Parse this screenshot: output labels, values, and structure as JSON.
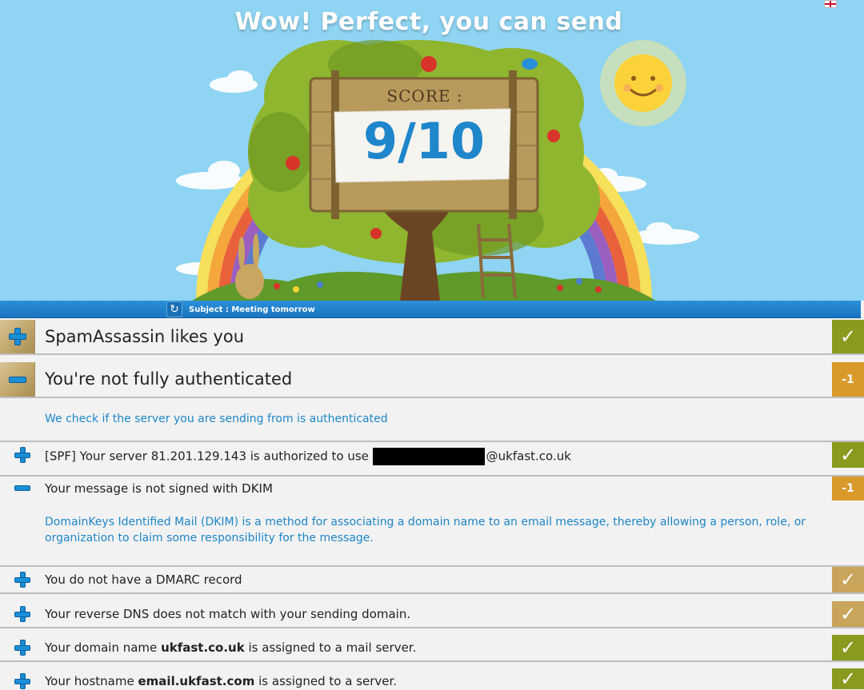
{
  "hero": {
    "title": "Wow! Perfect, you can send",
    "score_label": "SCORE :",
    "score_value": "9/10"
  },
  "subject_bar": {
    "text": "Subject : Meeting tomorrow"
  },
  "sections": [
    {
      "title": "SpamAssassin likes you",
      "state": "collapsed",
      "badge": "✓",
      "badge_color": "#8a9a1e"
    },
    {
      "title": "You're not fully authenticated",
      "state": "expanded",
      "badge": "-1",
      "badge_color": "#d99a2b",
      "description": "We check if the server you are sending from is authenticated"
    }
  ],
  "checks": [
    {
      "prefix": "[SPF] Your server 81.201.129.143 is authorized to use",
      "suffix": "@ukfast.co.uk",
      "badge": "✓",
      "badge_color": "#8a9a1e",
      "state": "collapsed"
    },
    {
      "title": "Your message is not signed with DKIM",
      "badge": "-1",
      "badge_color": "#d99a2b",
      "state": "expanded",
      "description": "DomainKeys Identified Mail (DKIM) is a method for associating a domain name to an email message, thereby allowing a person, role, or organization to claim some responsibility for the message."
    },
    {
      "title": "You do not have a DMARC record",
      "badge": "✓",
      "badge_color": "#c9a45b",
      "state": "collapsed"
    },
    {
      "title": "Your reverse DNS does not match with your sending domain.",
      "badge": "✓",
      "badge_color": "#c9a45b",
      "state": "collapsed"
    },
    {
      "prefix": "Your domain name",
      "bold": "ukfast.co.uk",
      "suffix": "is assigned to a mail server.",
      "badge": "✓",
      "badge_color": "#8a9a1e",
      "state": "collapsed"
    },
    {
      "prefix": "Your hostname",
      "bold": "email.ukfast.com",
      "suffix": "is assigned to a server.",
      "badge": "✓",
      "badge_color": "#8a9a1e",
      "state": "collapsed"
    }
  ],
  "icons": {
    "expand": "plus-icon",
    "collapse": "minus-icon",
    "refresh": "refresh-icon",
    "check": "check-icon",
    "language": "uk-flag-icon"
  }
}
